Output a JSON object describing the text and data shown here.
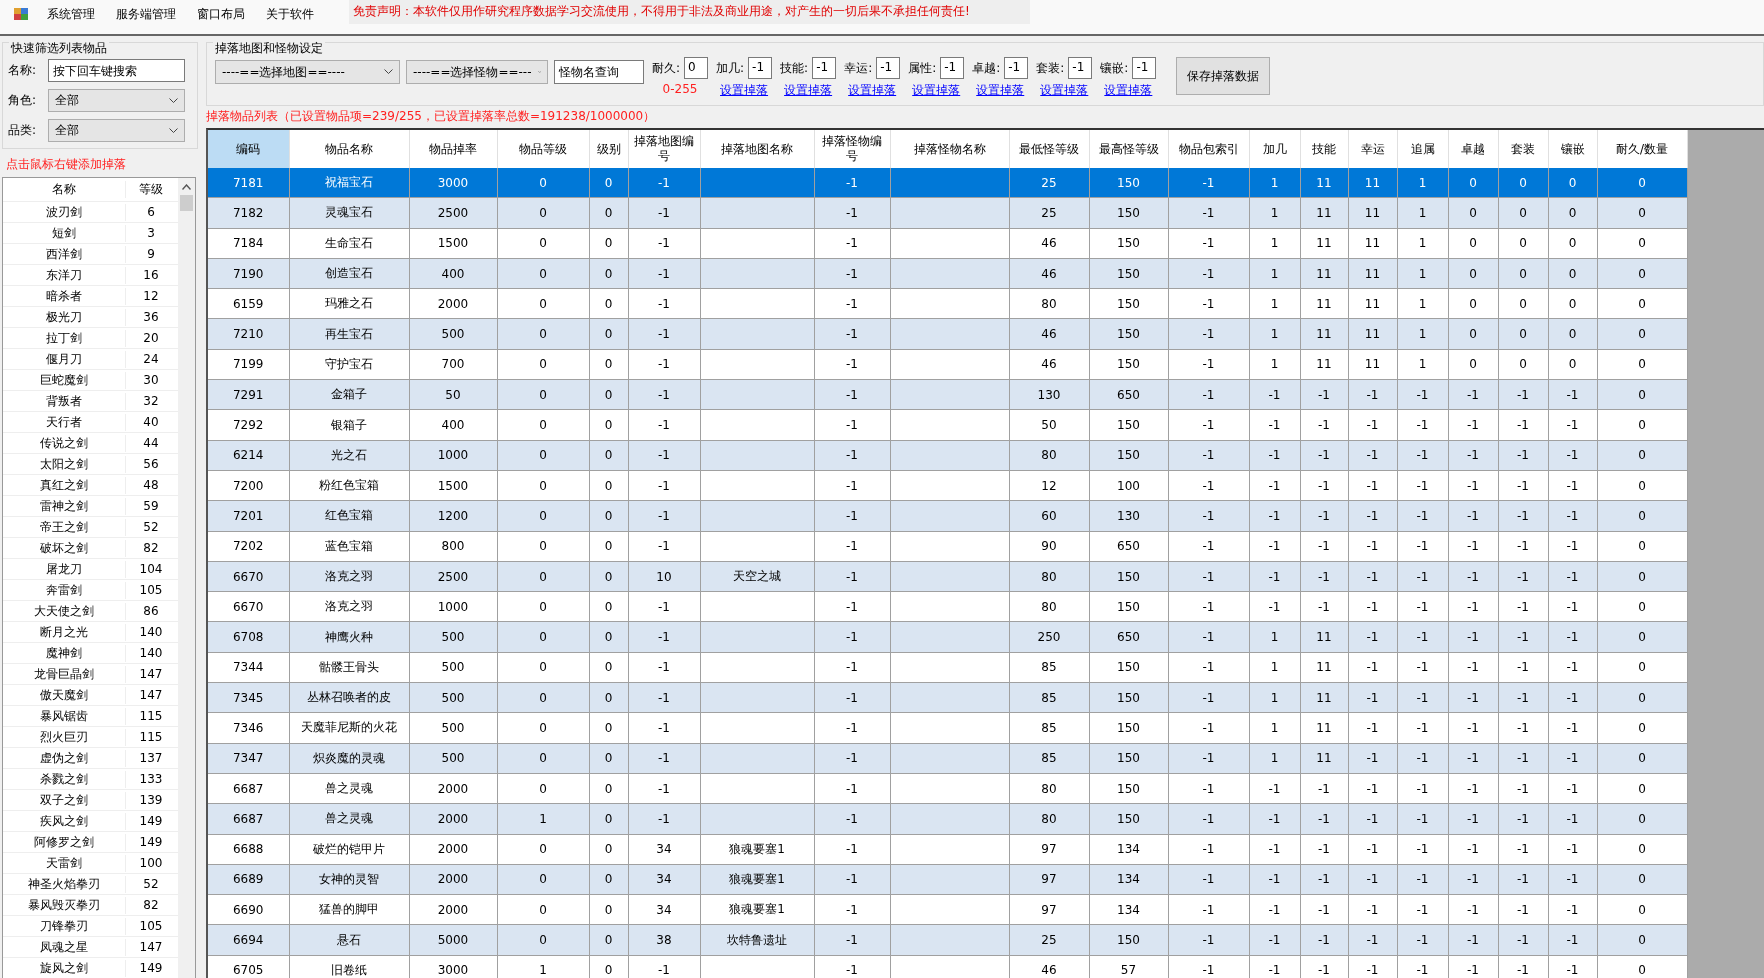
{
  "menu": [
    {
      "label": "系统管理"
    },
    {
      "label": "服务端管理"
    },
    {
      "label": "窗口布局"
    },
    {
      "label": "关于软件"
    }
  ],
  "disclaimer": "免责声明：本软件仅用作研究程序数据学习交流使用，不得用于非法及商业用途，对产生的一切后果不承担任何责任!",
  "filter_panel": {
    "title": "快速筛选列表物品",
    "fields": [
      {
        "label": "名称:",
        "kind": "input",
        "value": "按下回车键搜索"
      },
      {
        "label": "角色:",
        "kind": "select",
        "value": "全部"
      },
      {
        "label": "品类:",
        "kind": "select",
        "value": "全部"
      }
    ]
  },
  "item_list": {
    "title": "点击鼠标右键添加掉落",
    "columns": [
      "名称",
      "等级"
    ],
    "rows": [
      [
        "波刃剑",
        "6"
      ],
      [
        "短剑",
        "3"
      ],
      [
        "西洋剑",
        "9"
      ],
      [
        "东洋刀",
        "16"
      ],
      [
        "暗杀者",
        "12"
      ],
      [
        "极光刀",
        "36"
      ],
      [
        "拉丁剑",
        "20"
      ],
      [
        "偃月刀",
        "24"
      ],
      [
        "巨蛇魔剑",
        "30"
      ],
      [
        "背叛者",
        "32"
      ],
      [
        "天行者",
        "40"
      ],
      [
        "传说之剑",
        "44"
      ],
      [
        "太阳之剑",
        "56"
      ],
      [
        "真红之剑",
        "48"
      ],
      [
        "雷神之剑",
        "59"
      ],
      [
        "帝王之剑",
        "52"
      ],
      [
        "破坏之剑",
        "82"
      ],
      [
        "屠龙刀",
        "104"
      ],
      [
        "奔雷剑",
        "105"
      ],
      [
        "大天使之剑",
        "86"
      ],
      [
        "断月之光",
        "140"
      ],
      [
        "魔神剑",
        "140"
      ],
      [
        "龙骨巨晶剑",
        "147"
      ],
      [
        "傲天魔剑",
        "147"
      ],
      [
        "暴风锯齿",
        "115"
      ],
      [
        "烈火巨刃",
        "115"
      ],
      [
        "虚伪之剑",
        "137"
      ],
      [
        "杀戮之剑",
        "133"
      ],
      [
        "双子之剑",
        "139"
      ],
      [
        "疾风之剑",
        "149"
      ],
      [
        "阿修罗之剑",
        "149"
      ],
      [
        "天雷剑",
        "100"
      ],
      [
        "神圣火焰拳刃",
        "52"
      ],
      [
        "暴风毁灭拳刃",
        "82"
      ],
      [
        "刀锋拳刃",
        "105"
      ],
      [
        "凤魂之星",
        "147"
      ],
      [
        "旋风之剑",
        "149"
      ]
    ]
  },
  "drop_settings": {
    "title": "掉落地图和怪物设定",
    "map_select": "----==选择地图==----",
    "monster_select": "----==选择怪物==---",
    "monster_search": "怪物名查询",
    "params": [
      {
        "label": "耐久:",
        "value": "0",
        "note": "0-255"
      },
      {
        "label": "加几:",
        "value": "-1",
        "link": "设置掉落"
      },
      {
        "label": "技能:",
        "value": "-1",
        "link": "设置掉落"
      },
      {
        "label": "幸运:",
        "value": "-1",
        "link": "设置掉落"
      },
      {
        "label": "属性:",
        "value": "-1",
        "link": "设置掉落"
      },
      {
        "label": "卓越:",
        "value": "-1",
        "link": "设置掉落"
      },
      {
        "label": "套装:",
        "value": "-1",
        "link": "设置掉落"
      },
      {
        "label": "镶嵌:",
        "value": "-1",
        "link": "设置掉落"
      }
    ],
    "save_button": "保存掉落数据"
  },
  "drop_list": {
    "title": "掉落物品列表（已设置物品项=239/255，已设置掉落率总数=191238/1000000）",
    "columns": [
      {
        "label": "编码",
        "selected": true
      },
      {
        "label": "物品名称",
        "selected": false
      },
      {
        "label": "物品掉率",
        "selected": false
      },
      {
        "label": "物品等级",
        "selected": false
      },
      {
        "label": "级别",
        "selected": false
      },
      {
        "label": "掉落地图编号",
        "selected": false
      },
      {
        "label": "掉落地图名称",
        "selected": false
      },
      {
        "label": "掉落怪物编号",
        "selected": false
      },
      {
        "label": "掉落怪物名称",
        "selected": false
      },
      {
        "label": "最低怪等级",
        "selected": false
      },
      {
        "label": "最高怪等级",
        "selected": false
      },
      {
        "label": "物品包索引",
        "selected": false
      },
      {
        "label": "加几",
        "selected": false
      },
      {
        "label": "技能",
        "selected": false
      },
      {
        "label": "幸运",
        "selected": false
      },
      {
        "label": "追属",
        "selected": false
      },
      {
        "label": "卓越",
        "selected": false
      },
      {
        "label": "套装",
        "selected": false
      },
      {
        "label": "镶嵌",
        "selected": false
      },
      {
        "label": "耐久/数量",
        "selected": false
      }
    ],
    "rows": [
      {
        "selected": true,
        "cells": [
          "7181",
          "祝福宝石",
          "3000",
          "0",
          "0",
          "-1",
          "",
          "-1",
          "",
          "25",
          "150",
          "-1",
          "1",
          "11",
          "11",
          "1",
          "0",
          "0",
          "0",
          "0"
        ]
      },
      {
        "selected": false,
        "cells": [
          "7182",
          "灵魂宝石",
          "2500",
          "0",
          "0",
          "-1",
          "",
          "-1",
          "",
          "25",
          "150",
          "-1",
          "1",
          "11",
          "11",
          "1",
          "0",
          "0",
          "0",
          "0"
        ]
      },
      {
        "selected": false,
        "cells": [
          "7184",
          "生命宝石",
          "1500",
          "0",
          "0",
          "-1",
          "",
          "-1",
          "",
          "46",
          "150",
          "-1",
          "1",
          "11",
          "11",
          "1",
          "0",
          "0",
          "0",
          "0"
        ]
      },
      {
        "selected": false,
        "cells": [
          "7190",
          "创造宝石",
          "400",
          "0",
          "0",
          "-1",
          "",
          "-1",
          "",
          "46",
          "150",
          "-1",
          "1",
          "11",
          "11",
          "1",
          "0",
          "0",
          "0",
          "0"
        ]
      },
      {
        "selected": false,
        "cells": [
          "6159",
          "玛雅之石",
          "2000",
          "0",
          "0",
          "-1",
          "",
          "-1",
          "",
          "80",
          "150",
          "-1",
          "1",
          "11",
          "11",
          "1",
          "0",
          "0",
          "0",
          "0"
        ]
      },
      {
        "selected": false,
        "cells": [
          "7210",
          "再生宝石",
          "500",
          "0",
          "0",
          "-1",
          "",
          "-1",
          "",
          "46",
          "150",
          "-1",
          "1",
          "11",
          "11",
          "1",
          "0",
          "0",
          "0",
          "0"
        ]
      },
      {
        "selected": false,
        "cells": [
          "7199",
          "守护宝石",
          "700",
          "0",
          "0",
          "-1",
          "",
          "-1",
          "",
          "46",
          "150",
          "-1",
          "1",
          "11",
          "11",
          "1",
          "0",
          "0",
          "0",
          "0"
        ]
      },
      {
        "selected": false,
        "cells": [
          "7291",
          "金箱子",
          "50",
          "0",
          "0",
          "-1",
          "",
          "-1",
          "",
          "130",
          "650",
          "-1",
          "-1",
          "-1",
          "-1",
          "-1",
          "-1",
          "-1",
          "-1",
          "0"
        ]
      },
      {
        "selected": false,
        "cells": [
          "7292",
          "银箱子",
          "400",
          "0",
          "0",
          "-1",
          "",
          "-1",
          "",
          "50",
          "150",
          "-1",
          "-1",
          "-1",
          "-1",
          "-1",
          "-1",
          "-1",
          "-1",
          "0"
        ]
      },
      {
        "selected": false,
        "cells": [
          "6214",
          "光之石",
          "1000",
          "0",
          "0",
          "-1",
          "",
          "-1",
          "",
          "80",
          "150",
          "-1",
          "-1",
          "-1",
          "-1",
          "-1",
          "-1",
          "-1",
          "-1",
          "0"
        ]
      },
      {
        "selected": false,
        "cells": [
          "7200",
          "粉红色宝箱",
          "1500",
          "0",
          "0",
          "-1",
          "",
          "-1",
          "",
          "12",
          "100",
          "-1",
          "-1",
          "-1",
          "-1",
          "-1",
          "-1",
          "-1",
          "-1",
          "0"
        ]
      },
      {
        "selected": false,
        "cells": [
          "7201",
          "红色宝箱",
          "1200",
          "0",
          "0",
          "-1",
          "",
          "-1",
          "",
          "60",
          "130",
          "-1",
          "-1",
          "-1",
          "-1",
          "-1",
          "-1",
          "-1",
          "-1",
          "0"
        ]
      },
      {
        "selected": false,
        "cells": [
          "7202",
          "蓝色宝箱",
          "800",
          "0",
          "0",
          "-1",
          "",
          "-1",
          "",
          "90",
          "650",
          "-1",
          "-1",
          "-1",
          "-1",
          "-1",
          "-1",
          "-1",
          "-1",
          "0"
        ]
      },
      {
        "selected": false,
        "cells": [
          "6670",
          "洛克之羽",
          "2500",
          "0",
          "0",
          "10",
          "天空之城",
          "-1",
          "",
          "80",
          "150",
          "-1",
          "-1",
          "-1",
          "-1",
          "-1",
          "-1",
          "-1",
          "-1",
          "0"
        ]
      },
      {
        "selected": false,
        "cells": [
          "6670",
          "洛克之羽",
          "1000",
          "0",
          "0",
          "-1",
          "",
          "-1",
          "",
          "80",
          "150",
          "-1",
          "-1",
          "-1",
          "-1",
          "-1",
          "-1",
          "-1",
          "-1",
          "0"
        ]
      },
      {
        "selected": false,
        "cells": [
          "6708",
          "神鹰火种",
          "500",
          "0",
          "0",
          "-1",
          "",
          "-1",
          "",
          "250",
          "650",
          "-1",
          "1",
          "11",
          "-1",
          "-1",
          "-1",
          "-1",
          "-1",
          "0"
        ]
      },
      {
        "selected": false,
        "cells": [
          "7344",
          "骷髅王骨头",
          "500",
          "0",
          "0",
          "-1",
          "",
          "-1",
          "",
          "85",
          "150",
          "-1",
          "1",
          "11",
          "-1",
          "-1",
          "-1",
          "-1",
          "-1",
          "0"
        ]
      },
      {
        "selected": false,
        "cells": [
          "7345",
          "丛林召唤者的皮",
          "500",
          "0",
          "0",
          "-1",
          "",
          "-1",
          "",
          "85",
          "150",
          "-1",
          "1",
          "11",
          "-1",
          "-1",
          "-1",
          "-1",
          "-1",
          "0"
        ]
      },
      {
        "selected": false,
        "cells": [
          "7346",
          "天魔菲尼斯的火花",
          "500",
          "0",
          "0",
          "-1",
          "",
          "-1",
          "",
          "85",
          "150",
          "-1",
          "1",
          "11",
          "-1",
          "-1",
          "-1",
          "-1",
          "-1",
          "0"
        ]
      },
      {
        "selected": false,
        "cells": [
          "7347",
          "炽炎魔的灵魂",
          "500",
          "0",
          "0",
          "-1",
          "",
          "-1",
          "",
          "85",
          "150",
          "-1",
          "1",
          "11",
          "-1",
          "-1",
          "-1",
          "-1",
          "-1",
          "0"
        ]
      },
      {
        "selected": false,
        "cells": [
          "6687",
          "兽之灵魂",
          "2000",
          "0",
          "0",
          "-1",
          "",
          "-1",
          "",
          "80",
          "150",
          "-1",
          "-1",
          "-1",
          "-1",
          "-1",
          "-1",
          "-1",
          "-1",
          "0"
        ]
      },
      {
        "selected": false,
        "cells": [
          "6687",
          "兽之灵魂",
          "2000",
          "1",
          "0",
          "-1",
          "",
          "-1",
          "",
          "80",
          "150",
          "-1",
          "-1",
          "-1",
          "-1",
          "-1",
          "-1",
          "-1",
          "-1",
          "0"
        ]
      },
      {
        "selected": false,
        "cells": [
          "6688",
          "破烂的铠甲片",
          "2000",
          "0",
          "0",
          "34",
          "狼魂要塞1",
          "-1",
          "",
          "97",
          "134",
          "-1",
          "-1",
          "-1",
          "-1",
          "-1",
          "-1",
          "-1",
          "-1",
          "0"
        ]
      },
      {
        "selected": false,
        "cells": [
          "6689",
          "女神的灵智",
          "2000",
          "0",
          "0",
          "34",
          "狼魂要塞1",
          "-1",
          "",
          "97",
          "134",
          "-1",
          "-1",
          "-1",
          "-1",
          "-1",
          "-1",
          "-1",
          "-1",
          "0"
        ]
      },
      {
        "selected": false,
        "cells": [
          "6690",
          "猛兽的脚甲",
          "2000",
          "0",
          "0",
          "34",
          "狼魂要塞1",
          "-1",
          "",
          "97",
          "134",
          "-1",
          "-1",
          "-1",
          "-1",
          "-1",
          "-1",
          "-1",
          "-1",
          "0"
        ]
      },
      {
        "selected": false,
        "cells": [
          "6694",
          "悬石",
          "5000",
          "0",
          "0",
          "38",
          "坎特鲁遗址",
          "-1",
          "",
          "25",
          "150",
          "-1",
          "-1",
          "-1",
          "-1",
          "-1",
          "-1",
          "-1",
          "-1",
          "0"
        ]
      },
      {
        "selected": false,
        "cells": [
          "6705",
          "旧卷纸",
          "3000",
          "1",
          "0",
          "-1",
          "",
          "-1",
          "",
          "46",
          "57",
          "-1",
          "-1",
          "-1",
          "-1",
          "-1",
          "-1",
          "-1",
          "-1",
          "0"
        ]
      }
    ]
  }
}
